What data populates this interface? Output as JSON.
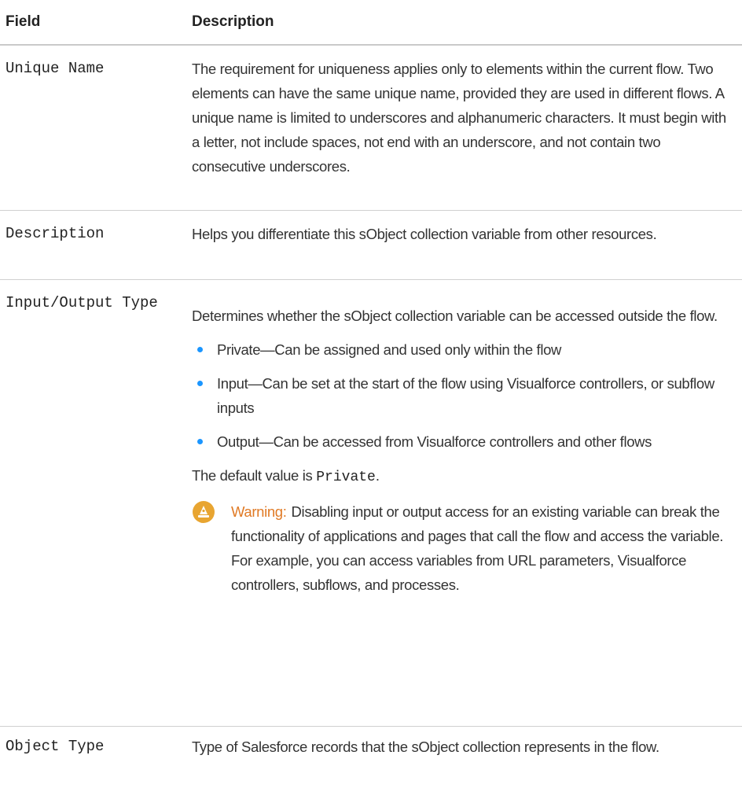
{
  "headers": {
    "field": "Field",
    "description": "Description"
  },
  "rows": {
    "unique_name": {
      "field": "Unique Name",
      "description": "The requirement for uniqueness applies only to elements within the current flow. Two elements can have the same unique name, provided they are used in different flows. A unique name is limited to underscores and alphanumeric characters. It must begin with a letter, not include spaces, not end with an underscore, and not contain two consecutive underscores."
    },
    "description": {
      "field": "Description",
      "description": "Helps you differentiate this sObject collection variable from other resources."
    },
    "io_type": {
      "field": "Input/Output Type",
      "intro": "Determines whether the sObject collection variable can be accessed outside the flow.",
      "bullets": [
        "Private—Can be assigned and used only within the flow",
        "Input—Can be set at the start of the flow using Visualforce controllers, or subflow inputs",
        "Output—Can be accessed from Visualforce controllers and other flows"
      ],
      "default_prefix": "The default value is ",
      "default_value": "Private",
      "default_suffix": ".",
      "warning_title": "Warning:",
      "warning_text": "Disabling input or output access for an existing variable can break the functionality of applications and pages that call the flow and access the variable. For example, you can access variables from URL parameters, Visualforce controllers, subflows, and processes.",
      "warning_icon": "warning-icon",
      "warning_color": "#e07a25"
    },
    "object_type": {
      "field": "Object Type",
      "description": "Type of Salesforce records that the sObject collection represents in the flow."
    }
  },
  "colors": {
    "bullet": "#1b96ff",
    "warning_icon_bg": "#e8a531"
  }
}
